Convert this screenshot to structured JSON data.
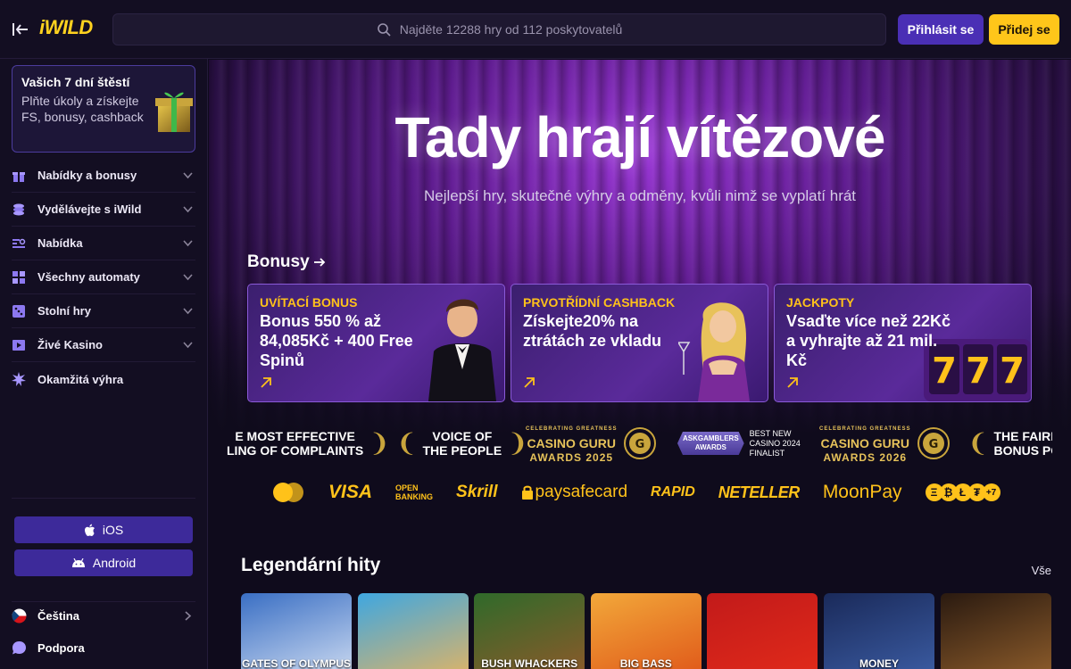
{
  "header": {
    "logo": "iWILD",
    "search_placeholder": "Najděte 12288 hry od 112 poskytovatelů",
    "login_label": "Přihlásit se",
    "signup_label": "Přidej se"
  },
  "sidebar": {
    "lucky": {
      "title": "Vašich 7 dní štěstí",
      "desc": "Plňte úkoly a získejte FS, bonusy, cashback"
    },
    "items": [
      {
        "label": "Nabídky a bonusy",
        "icon": "gift-icon"
      },
      {
        "label": "Vydělávejte s iWild",
        "icon": "coins-icon"
      },
      {
        "label": "Nabídka",
        "icon": "list-search-icon"
      },
      {
        "label": "Všechny automaty",
        "icon": "grid-icon"
      },
      {
        "label": "Stolní hry",
        "icon": "dice-icon"
      },
      {
        "label": "Živé Kasino",
        "icon": "play-icon"
      },
      {
        "label": "Okamžitá výhra",
        "icon": "burst-icon"
      }
    ],
    "ios_label": "iOS",
    "android_label": "Android",
    "language_label": "Čeština",
    "support_label": "Podpora"
  },
  "hero": {
    "title": "Tady hrají vítězové",
    "subtitle": "Nejlepší hry, skutečné výhry a odměny, kvůli nimž se vyplatí hrát"
  },
  "bonuses": {
    "heading": "Bonusy",
    "cards": [
      {
        "tag": "UVÍTACÍ BONUS",
        "text": "Bonus 550 % až 84,085Kč + 400 Free Spinů"
      },
      {
        "tag": "PRVOTŘÍDNÍ CASHBACK",
        "text": "Získejte20% na ztrátách ze vkladu"
      },
      {
        "tag": "JACKPOTY",
        "text": "Vsaďte více než 22Kč a vyhrajte až 21 mil. Kč"
      }
    ]
  },
  "awards": [
    {
      "line1": "E MOST EFFECTIVE",
      "line2": "LING OF COMPLAINTS"
    },
    {
      "line1": "VOICE OF",
      "line2": "THE PEOPLE"
    },
    {
      "small": "CELEBRATING GREATNESS",
      "line1": "CASINO GURU",
      "line2": "AWARDS 2025"
    },
    {
      "badge": "ASKGAMBLERS",
      "badge2": "AWARDS",
      "line1": "BEST NEW",
      "line2": "CASINO 2024",
      "line3": "FINALIST"
    },
    {
      "small": "CELEBRATING GREATNESS",
      "line1": "CASINO GURU",
      "line2": "AWARDS 2026"
    },
    {
      "line1": "THE FAIRE",
      "line2": "BONUS POL"
    }
  ],
  "payments": {
    "visa": "VISA",
    "open_banking_1": "OPEN",
    "open_banking_2": "BANKING",
    "skrill": "Skrill",
    "paysafe": "paysafecard",
    "rapid": "RAPID",
    "neteller": "NETELLER",
    "moonpay": "MoonPay",
    "crypto_more": "+7"
  },
  "hits": {
    "heading": "Legendární hity",
    "all_label": "Vše",
    "tiles": [
      {
        "caption": "GATES OF OLYMPUS",
        "color1": "#3a6fc4",
        "color2": "#c9d8f0"
      },
      {
        "caption": "",
        "color1": "#3fa7e0",
        "color2": "#d9b36a"
      },
      {
        "caption": "BUSH WHACKERS",
        "color1": "#2f6a2a",
        "color2": "#8a5a2a"
      },
      {
        "caption": "BIG BASS",
        "color1": "#f2a83a",
        "color2": "#e05a1a"
      },
      {
        "caption": "",
        "color1": "#c21a1a",
        "color2": "#e02a1a"
      },
      {
        "caption": "MONEY",
        "color1": "#1a2a5a",
        "color2": "#3a5aa0"
      },
      {
        "caption": "",
        "color1": "#2a1a10",
        "color2": "#8a5a2a"
      }
    ]
  }
}
